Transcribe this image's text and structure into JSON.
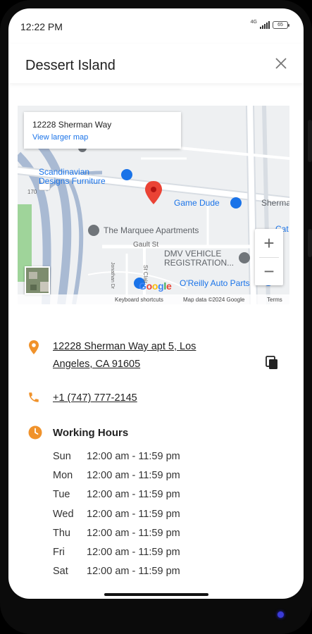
{
  "status_bar": {
    "time": "12:22 PM",
    "network_label": "4G",
    "battery_label": "65",
    "icons": [
      "signal-icon",
      "battery-icon"
    ]
  },
  "header": {
    "title": "Dessert Island",
    "close_icon": "close-icon"
  },
  "map": {
    "card": {
      "address": "12228 Sherman Way",
      "link_label": "View larger map"
    },
    "pois": {
      "scandinavian": "Scandinavian\nDesigns Furniture",
      "game_dude": "Game Dude",
      "sherman": "Sherma",
      "marquee": "The Marquee Apartments",
      "dmv": "DMV VEHICLE\nREGISTRATION...",
      "oreilly": "O'Reilly Auto Parts",
      "cat": "Cat"
    },
    "road_labels": {
      "gault": "Gault St",
      "hwy": "170",
      "jonathan": "Jonathan Dr",
      "st_clair": "St Clair"
    },
    "zoom_in_label": "+",
    "zoom_out_label": "−",
    "logo_letters": [
      "G",
      "o",
      "o",
      "g",
      "l",
      "e"
    ],
    "footer": {
      "shortcuts": "Keyboard shortcuts",
      "data": "Map data ©2024 Google",
      "terms": "Terms"
    },
    "colors": {
      "pin": "#ea4335",
      "poi_blue": "#1a73e8"
    }
  },
  "info": {
    "address_line1": "12228 Sherman Way apt 5, Los",
    "address_line2": "Angeles, CA 91605",
    "phone": "+1 (747) 777-2145",
    "hours_title": "Working Hours",
    "accent_color": "#f0922b",
    "hours": [
      {
        "day": "Sun",
        "time": "12:00 am - 11:59 pm"
      },
      {
        "day": "Mon",
        "time": "12:00 am - 11:59 pm"
      },
      {
        "day": "Tue",
        "time": "12:00 am - 11:59 pm"
      },
      {
        "day": "Wed",
        "time": "12:00 am - 11:59 pm"
      },
      {
        "day": "Thu",
        "time": "12:00 am - 11:59 pm"
      },
      {
        "day": "Fri",
        "time": "12:00 am - 11:59 pm"
      },
      {
        "day": "Sat",
        "time": "12:00 am - 11:59 pm"
      }
    ]
  }
}
